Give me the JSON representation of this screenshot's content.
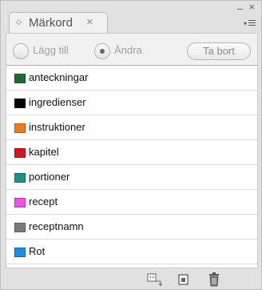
{
  "panel": {
    "tab_title": "Märkord",
    "tab_close_glyph": "×",
    "close_glyph": "×"
  },
  "toolbar": {
    "add_label": "Lägg till",
    "change_label": "Ändra",
    "delete_label": "Ta bort",
    "selected_option": "Ändra"
  },
  "tags": [
    {
      "label": "anteckningar",
      "color": "#1f6b35"
    },
    {
      "label": "ingredienser",
      "color": "#000000"
    },
    {
      "label": "instruktioner",
      "color": "#f07a20"
    },
    {
      "label": "kapitel",
      "color": "#d8151f"
    },
    {
      "label": "portioner",
      "color": "#1f8f8a"
    },
    {
      "label": "recept",
      "color": "#ee4fe0"
    },
    {
      "label": "receptnamn",
      "color": "#7b7b7b"
    },
    {
      "label": "Rot",
      "color": "#1a8ee0"
    }
  ],
  "bottom_icons": [
    "tag-to-element-icon",
    "new-tag-icon",
    "delete-tag-icon"
  ]
}
